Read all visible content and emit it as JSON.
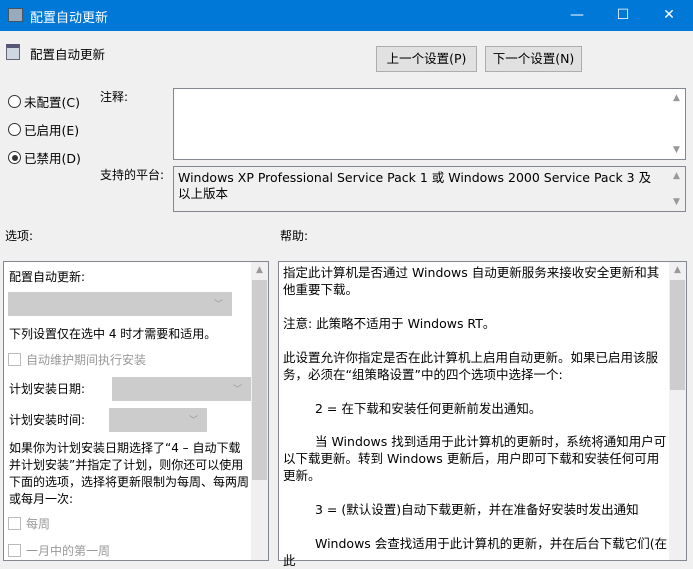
{
  "window": {
    "title": "配置自动更新",
    "minimize": "—",
    "maximize": "☐",
    "close": "✕"
  },
  "header": {
    "policy_name": "配置自动更新",
    "prev_button": "上一个设置(P)",
    "next_button": "下一个设置(N)"
  },
  "state": {
    "options": [
      {
        "label": "未配置(C)",
        "selected": false
      },
      {
        "label": "已启用(E)",
        "selected": false
      },
      {
        "label": "已禁用(D)",
        "selected": true
      }
    ]
  },
  "comment": {
    "label": "注释:",
    "value": ""
  },
  "platform": {
    "label": "支持的平台:",
    "value": "Windows XP Professional Service Pack 1 或 Windows 2000 Service Pack 3 及以上版本"
  },
  "options_label": "选项:",
  "help_label": "帮助:",
  "options": {
    "configure_label": "配置自动更新:",
    "configure_value": "",
    "note": "下列设置仅在选中 4 时才需要和适用。",
    "maintenance_checkbox": "自动维护期间执行安装",
    "day_label": "计划安装日期:",
    "time_label": "计划安装时间:",
    "paragraph": "如果你为计划安装日期选择了“4 – 自动下载并计划安装”并指定了计划，则你还可以使用下面的选项，选择将更新限制为每周、每两周或每月一次:",
    "weekly_checkbox": "每周",
    "first_week_checkbox": "一月中的第一周"
  },
  "help": {
    "paragraphs": [
      "指定此计算机是否通过 Windows 自动更新服务来接收安全更新和其他重要下载。",
      "注意: 此策略不适用于 Windows RT。",
      "此设置允许你指定是否在此计算机上启用自动更新。如果已启用该服务，必须在“组策略设置”中的四个选项中选择一个:",
      "2 = 在下载和安装任何更新前发出通知。",
      "当 Windows 找到适用于此计算机的更新时，系统将通知用户可以下载更新。转到 Windows 更新后，用户即可下载和安装任何可用更新。",
      "3 = (默认设置)自动下载更新，并在准备好安装时发出通知",
      "Windows 会查找适用于此计算机的更新，并在后台下载它们(在此"
    ]
  }
}
